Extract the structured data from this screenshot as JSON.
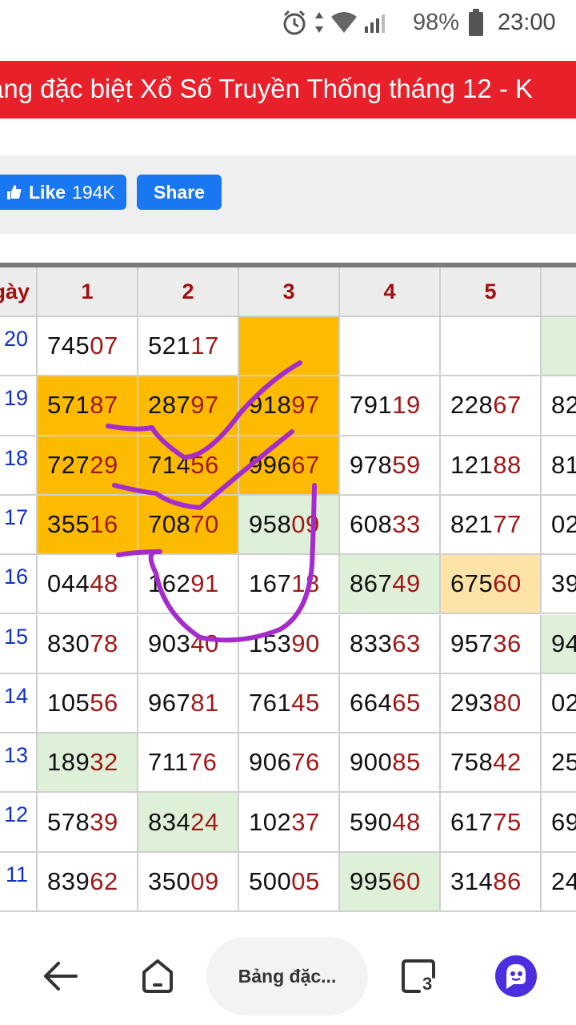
{
  "status_bar": {
    "battery": "98%",
    "time": "23:00",
    "icons": [
      "alarm-icon",
      "data-arrows-icon",
      "wifi-icon",
      "signal-icon",
      "battery-icon"
    ]
  },
  "banner": {
    "title": "ảng đặc biệt Xổ Số Truyền Thống tháng 12 - K"
  },
  "social": {
    "like_label": "Like",
    "like_count": "194K",
    "share_label": "Share"
  },
  "table": {
    "day_header": "gày",
    "columns": [
      "1",
      "2",
      "3",
      "4",
      "5"
    ],
    "rows": [
      {
        "day": "20",
        "cells": [
          {
            "head": "745",
            "tail": "07",
            "bg": ""
          },
          {
            "head": "521",
            "tail": "17",
            "bg": ""
          },
          {
            "head": "",
            "tail": "",
            "bg": "orange"
          },
          {
            "head": "",
            "tail": "",
            "bg": ""
          },
          {
            "head": "",
            "tail": "",
            "bg": ""
          },
          {
            "head": "",
            "tail": "",
            "bg": "green"
          }
        ]
      },
      {
        "day": "19",
        "cells": [
          {
            "head": "571",
            "tail": "87",
            "bg": "orange"
          },
          {
            "head": "287",
            "tail": "97",
            "bg": "orange"
          },
          {
            "head": "918",
            "tail": "97",
            "bg": "orange"
          },
          {
            "head": "791",
            "tail": "19",
            "bg": ""
          },
          {
            "head": "228",
            "tail": "67",
            "bg": ""
          },
          {
            "head": "82",
            "tail": "",
            "bg": ""
          }
        ]
      },
      {
        "day": "18",
        "cells": [
          {
            "head": "727",
            "tail": "29",
            "bg": "orange"
          },
          {
            "head": "714",
            "tail": "56",
            "bg": "orange"
          },
          {
            "head": "996",
            "tail": "67",
            "bg": "orange"
          },
          {
            "head": "978",
            "tail": "59",
            "bg": ""
          },
          {
            "head": "121",
            "tail": "88",
            "bg": ""
          },
          {
            "head": "81",
            "tail": "",
            "bg": ""
          }
        ]
      },
      {
        "day": "17",
        "cells": [
          {
            "head": "355",
            "tail": "16",
            "bg": "orange"
          },
          {
            "head": "708",
            "tail": "70",
            "bg": "orange"
          },
          {
            "head": "958",
            "tail": "09",
            "bg": "green"
          },
          {
            "head": "608",
            "tail": "33",
            "bg": ""
          },
          {
            "head": "821",
            "tail": "77",
            "bg": ""
          },
          {
            "head": "02",
            "tail": "",
            "bg": ""
          }
        ]
      },
      {
        "day": "16",
        "cells": [
          {
            "head": "044",
            "tail": "48",
            "bg": ""
          },
          {
            "head": "162",
            "tail": "91",
            "bg": ""
          },
          {
            "head": "167",
            "tail": "18",
            "bg": ""
          },
          {
            "head": "867",
            "tail": "49",
            "bg": "green"
          },
          {
            "head": "675",
            "tail": "60",
            "bg": "cream"
          },
          {
            "head": "39",
            "tail": "",
            "bg": ""
          }
        ]
      },
      {
        "day": "15",
        "cells": [
          {
            "head": "830",
            "tail": "78",
            "bg": ""
          },
          {
            "head": "903",
            "tail": "40",
            "bg": ""
          },
          {
            "head": "153",
            "tail": "90",
            "bg": ""
          },
          {
            "head": "833",
            "tail": "63",
            "bg": ""
          },
          {
            "head": "957",
            "tail": "36",
            "bg": ""
          },
          {
            "head": "94",
            "tail": "",
            "bg": "green"
          }
        ]
      },
      {
        "day": "14",
        "cells": [
          {
            "head": "105",
            "tail": "56",
            "bg": ""
          },
          {
            "head": "967",
            "tail": "81",
            "bg": ""
          },
          {
            "head": "761",
            "tail": "45",
            "bg": ""
          },
          {
            "head": "664",
            "tail": "65",
            "bg": ""
          },
          {
            "head": "293",
            "tail": "80",
            "bg": ""
          },
          {
            "head": "02",
            "tail": "",
            "bg": ""
          }
        ]
      },
      {
        "day": "13",
        "cells": [
          {
            "head": "189",
            "tail": "32",
            "bg": "green"
          },
          {
            "head": "711",
            "tail": "76",
            "bg": ""
          },
          {
            "head": "906",
            "tail": "76",
            "bg": ""
          },
          {
            "head": "900",
            "tail": "85",
            "bg": ""
          },
          {
            "head": "758",
            "tail": "42",
            "bg": ""
          },
          {
            "head": "25",
            "tail": "",
            "bg": ""
          }
        ]
      },
      {
        "day": "12",
        "cells": [
          {
            "head": "578",
            "tail": "39",
            "bg": ""
          },
          {
            "head": "834",
            "tail": "24",
            "bg": "green"
          },
          {
            "head": "102",
            "tail": "37",
            "bg": ""
          },
          {
            "head": "590",
            "tail": "48",
            "bg": ""
          },
          {
            "head": "617",
            "tail": "75",
            "bg": ""
          },
          {
            "head": "69",
            "tail": "",
            "bg": ""
          }
        ]
      },
      {
        "day": "11",
        "cells": [
          {
            "head": "839",
            "tail": "62",
            "bg": ""
          },
          {
            "head": "350",
            "tail": "09",
            "bg": ""
          },
          {
            "head": "500",
            "tail": "05",
            "bg": ""
          },
          {
            "head": "995",
            "tail": "60",
            "bg": "green"
          },
          {
            "head": "314",
            "tail": "86",
            "bg": ""
          },
          {
            "head": "24",
            "tail": "",
            "bg": ""
          }
        ]
      }
    ]
  },
  "colors": {
    "banner": "#e8202a",
    "facebook": "#1a77f2",
    "highlight_orange": "#fdbb00",
    "highlight_green": "#dff0d8",
    "highlight_cream": "#fde3a7",
    "number_tail": "#a01818",
    "annotation": "#a62bcc"
  },
  "bottom_nav": {
    "tab_title": "Bảng đặc...",
    "tab_count": "3",
    "icons": [
      "back-arrow-icon",
      "home-icon",
      "tabs-icon",
      "assistant-icon"
    ]
  }
}
